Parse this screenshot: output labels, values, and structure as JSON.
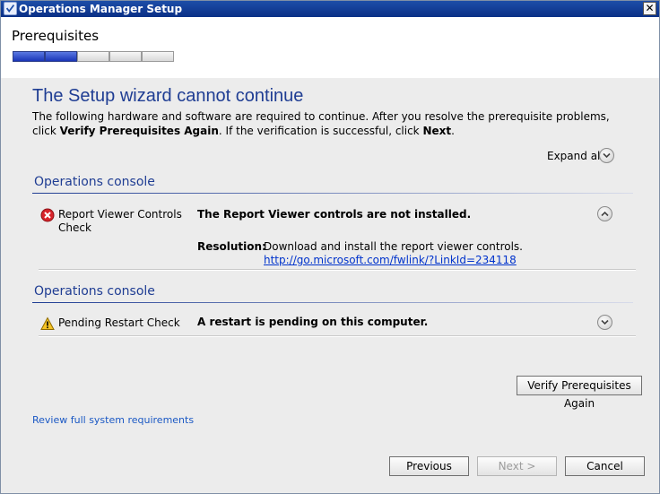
{
  "window": {
    "title": "Operations Manager Setup",
    "close_label": "✕"
  },
  "header": {
    "page_title": "Prerequisites",
    "progress": {
      "total_steps": 5,
      "completed_steps": 2
    }
  },
  "main": {
    "headline": "The Setup wizard cannot continue",
    "intro_part1": "The following hardware and software are required to continue.  After you resolve the prerequisite problems, click ",
    "intro_bold1": "Verify Prerequisites Again",
    "intro_part2": ".  If the verification is successful, click ",
    "intro_bold2": "Next",
    "intro_part3": ".",
    "expand_all_label": "Expand all"
  },
  "sections": [
    {
      "title": "Operations console",
      "check": {
        "status_icon": "error-icon",
        "name": "Report Viewer Controls Check",
        "message": "The Report Viewer controls are not installed.",
        "expanded": true,
        "resolution_label": "Resolution:",
        "resolution_text": "Download and install the report viewer controls. ",
        "resolution_link": "http://go.microsoft.com/fwlink/?LinkId=234118"
      }
    },
    {
      "title": "Operations console",
      "check": {
        "status_icon": "warning-icon",
        "name": "Pending Restart Check",
        "message": "A restart is pending on this computer.",
        "expanded": false
      }
    }
  ],
  "actions": {
    "verify_label": "Verify Prerequisites Again",
    "review_link": "Review full system requirements"
  },
  "footer": {
    "previous_label": "Previous",
    "next_label": "Next >",
    "cancel_label": "Cancel"
  },
  "colors": {
    "accent": "#1f3d93",
    "link": "#0033cc",
    "titlebar": "#0a2f86"
  }
}
